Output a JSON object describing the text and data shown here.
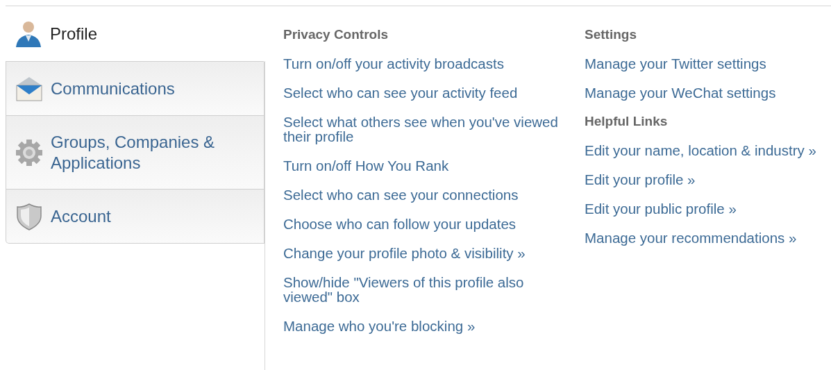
{
  "sidebar": {
    "items": [
      {
        "label": "Profile",
        "selected": true
      },
      {
        "label": "Communications",
        "selected": false
      },
      {
        "label": "Groups, Companies & Applications",
        "selected": false
      },
      {
        "label": "Account",
        "selected": false
      }
    ]
  },
  "columns": [
    {
      "sections": [
        {
          "heading": "Privacy Controls",
          "links": [
            "Turn on/off your activity broadcasts",
            "Select who can see your activity feed",
            "Select what others see when you've viewed their profile",
            "Turn on/off How You Rank",
            "Select who can see your connections",
            "Choose who can follow your updates",
            "Change your profile photo & visibility »",
            "Show/hide \"Viewers of this profile also viewed\" box",
            "Manage who you're blocking »"
          ]
        }
      ]
    },
    {
      "sections": [
        {
          "heading": "Settings",
          "links": [
            "Manage your Twitter settings",
            "Manage your WeChat settings"
          ]
        },
        {
          "heading": "Helpful Links",
          "links": [
            "Edit your name, location & industry »",
            "Edit your profile »",
            "Edit your public profile »",
            "Manage your recommendations »"
          ]
        }
      ]
    }
  ]
}
